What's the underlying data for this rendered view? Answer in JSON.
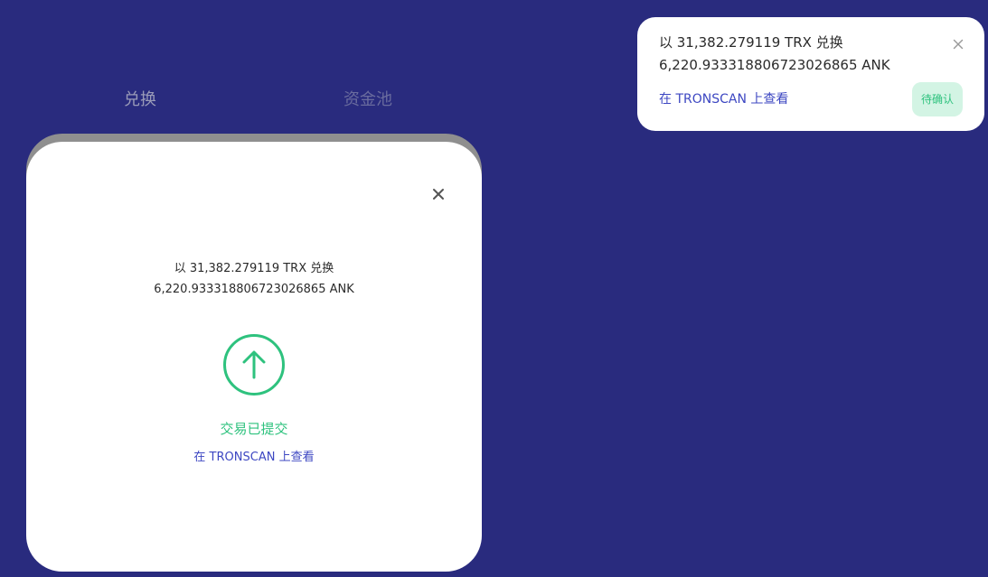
{
  "tabs": {
    "swap": "兑换",
    "pool": "资金池"
  },
  "modal": {
    "summary_line1": "以 31,382.279119 TRX 兑换",
    "summary_line2": "6,220.933318806723026865 ANK",
    "status": "交易已提交",
    "link": "在 TRONSCAN 上查看",
    "close_icon": "close-icon",
    "status_icon": "arrow-up-circle-icon"
  },
  "toast": {
    "line1": "以 31,382.279119 TRX 兑换",
    "line2": "6,220.933318806723026865 ANK",
    "link": "在 TRONSCAN 上查看",
    "badge": "待确认",
    "close_icon": "close-icon"
  },
  "colors": {
    "background": "#292b7e",
    "accent_green": "#2ec27e",
    "link_blue": "#3d47c2",
    "badge_bg": "#d3f4e4"
  }
}
